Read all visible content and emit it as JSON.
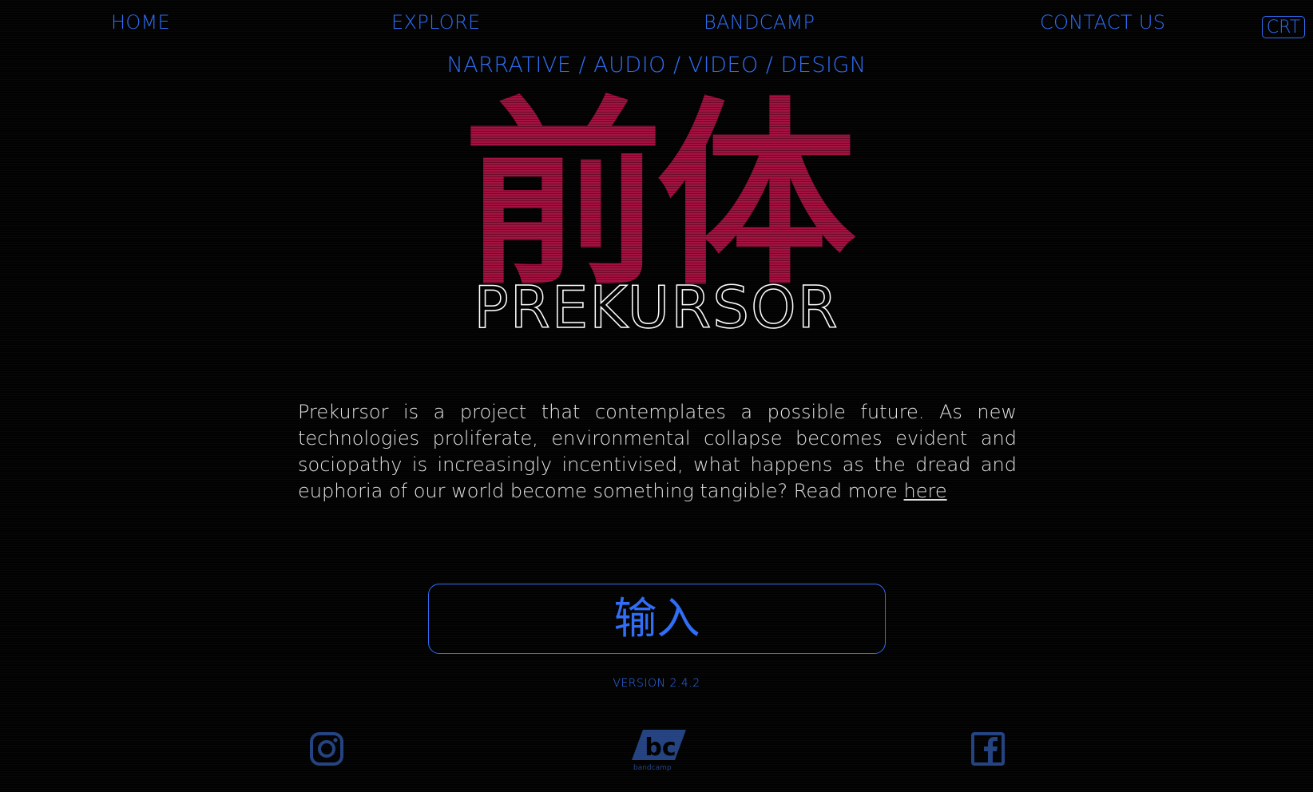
{
  "nav": {
    "items": [
      {
        "label": "HOME"
      },
      {
        "label": "EXPLORE"
      },
      {
        "label": "BANDCAMP"
      },
      {
        "label": "CONTACT US"
      }
    ],
    "crt_toggle": "CRT"
  },
  "subtitle": "NARRATIVE / AUDIO / VIDEO / DESIGN",
  "hero": {
    "cjk_title": "前体",
    "title": "PREKURSOR"
  },
  "description": {
    "text": "Prekursor is a project that contemplates a possible future. As new technologies proliferate, environmental collapse becomes evident and sociopathy is increasingly incentivised, what happens as the dread and euphoria of our world become something tangible? Read more ",
    "link_label": "here"
  },
  "enter_button": {
    "label": "输入"
  },
  "version": "VERSION 2.4.2",
  "social": {
    "instagram_icon": "instagram-icon",
    "bandcamp_icon": "bandcamp-logo",
    "bandcamp_text": "bandcamp",
    "bandcamp_mark": "bc",
    "facebook_icon": "facebook-icon"
  },
  "colors": {
    "accent": "#2f6df5",
    "hero_red": "#a3103f",
    "text": "#e2e2e2",
    "background": "#020203",
    "social_icon": "#23427f"
  }
}
